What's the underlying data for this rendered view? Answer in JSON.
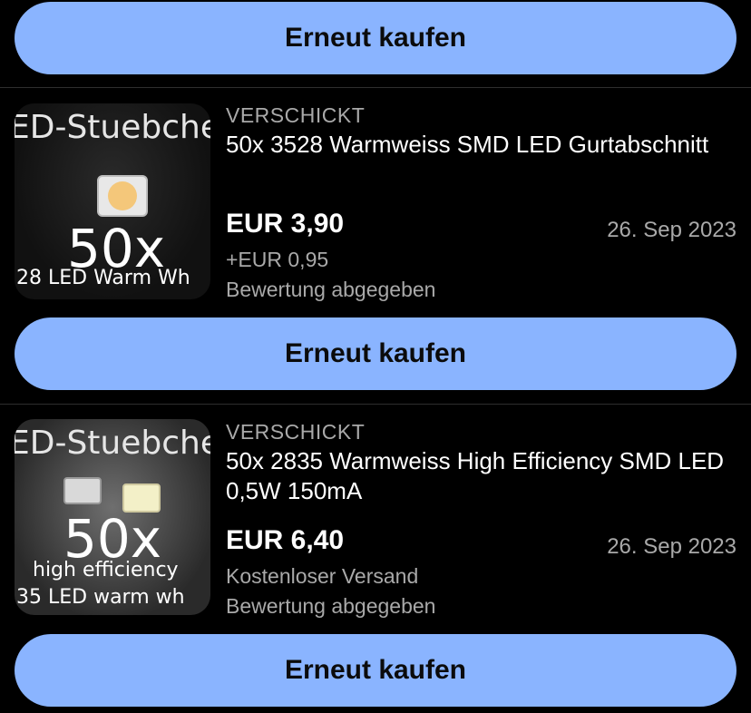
{
  "buttons": {
    "buy_again": "Erneut kaufen"
  },
  "orders": [
    {
      "status": "VERSCHICKT",
      "title": "50x 3528 Warmweiss SMD LED Gurtabschnitt",
      "price": "EUR 3,90",
      "shipping": "+EUR 0,95",
      "feedback": "Bewertung abgegeben",
      "date": "26. Sep 2023",
      "thumb": {
        "brand": "ED-Stuebche",
        "count": "50x",
        "caption": "28 LED Warm Wh"
      }
    },
    {
      "status": "VERSCHICKT",
      "title": "50x 2835 Warmweiss High Efficiency SMD LED 0,5W 150mA",
      "price": "EUR 6,40",
      "shipping": "Kostenloser Versand",
      "feedback": "Bewertung abgegeben",
      "date": "26. Sep 2023",
      "thumb": {
        "brand": "ED-Stuebche",
        "count": "50x",
        "line2": "high efficiency",
        "caption": "35 LED warm wh"
      }
    }
  ],
  "colors": {
    "button_bg": "#8ab4ff",
    "background": "#000000",
    "muted_text": "#a9a9a9"
  }
}
